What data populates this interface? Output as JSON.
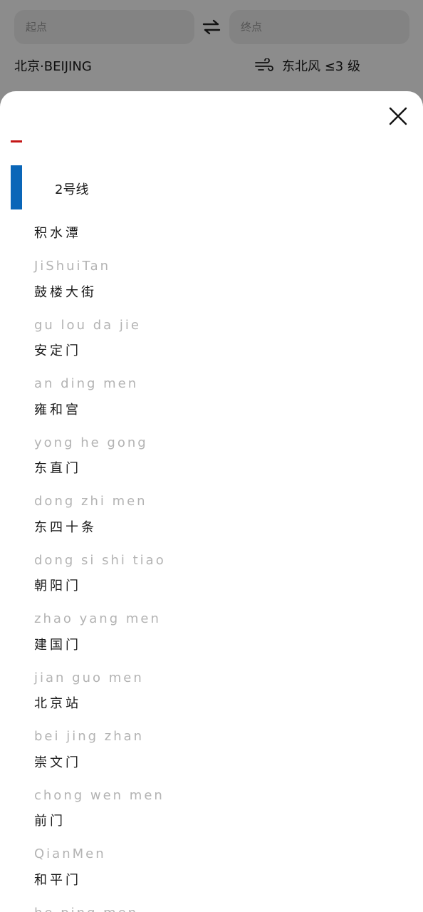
{
  "background": {
    "from_placeholder": "起点",
    "to_placeholder": "终点",
    "city": "北京·BEIJING",
    "wind": "东北风 ≤3 级"
  },
  "sheet": {
    "line_name": "2号线",
    "line_color": "#0a66b8",
    "accent_color": "#c41616",
    "stations": [
      {
        "cn": "积水潭",
        "py": "JiShuiTan"
      },
      {
        "cn": "鼓楼大街",
        "py": "gu lou da jie"
      },
      {
        "cn": "安定门",
        "py": "an ding men"
      },
      {
        "cn": "雍和宫",
        "py": "yong he gong"
      },
      {
        "cn": "东直门",
        "py": "dong zhi men"
      },
      {
        "cn": "东四十条",
        "py": "dong si shi tiao"
      },
      {
        "cn": "朝阳门",
        "py": "zhao yang men"
      },
      {
        "cn": "建国门",
        "py": "jian guo men"
      },
      {
        "cn": "北京站",
        "py": "bei jing zhan"
      },
      {
        "cn": "崇文门",
        "py": "chong wen men"
      },
      {
        "cn": "前门",
        "py": "QianMen"
      },
      {
        "cn": "和平门",
        "py": "he ping men"
      }
    ]
  }
}
